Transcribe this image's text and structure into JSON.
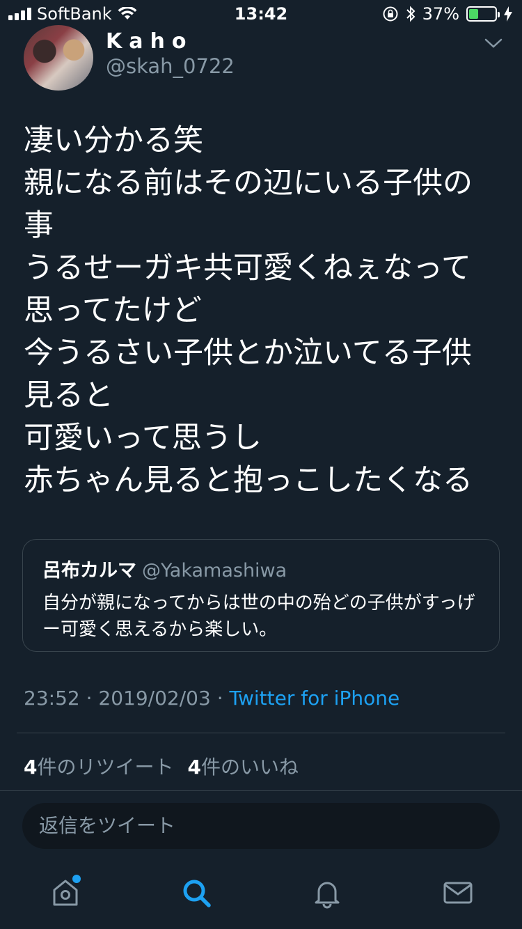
{
  "status_bar": {
    "carrier": "SoftBank",
    "time": "13:42",
    "battery_percent": "37%",
    "battery_level": 0.37
  },
  "tweet": {
    "author_name": "Kaho",
    "author_handle": "@skah_0722",
    "text_lines": [
      "凄い分かる笑",
      "親になる前はその辺にいる子供の",
      "事",
      "うるせーガキ共可愛くねぇなって",
      "思ってたけど",
      "今うるさい子供とか泣いてる子供",
      "見ると",
      "可愛いって思うし",
      "赤ちゃん見ると抱っこしたくなる"
    ],
    "quote": {
      "name": "呂布カルマ",
      "handle": "@Yakamashiwa",
      "text": "自分が親になってからは世の中の殆どの子供がすっげー可愛く思えるから楽しい。"
    },
    "time": "23:52",
    "date": "2019/02/03",
    "separator": "·",
    "source": "Twitter for iPhone",
    "retweet_count": "4",
    "retweet_label": "件のリツイート",
    "like_count": "4",
    "like_label": "件のいいね"
  },
  "reply": {
    "placeholder": "返信をツイート"
  },
  "tab_bar": {
    "items": [
      "home-icon",
      "search-icon",
      "notifications-icon",
      "messages-icon"
    ],
    "active": "search-icon",
    "accent": "#1da1f2",
    "inactive": "#8899a6"
  },
  "colors": {
    "background": "#15202b",
    "secondary_text": "#8899a6",
    "link": "#1da1f2",
    "border": "#38444d"
  }
}
